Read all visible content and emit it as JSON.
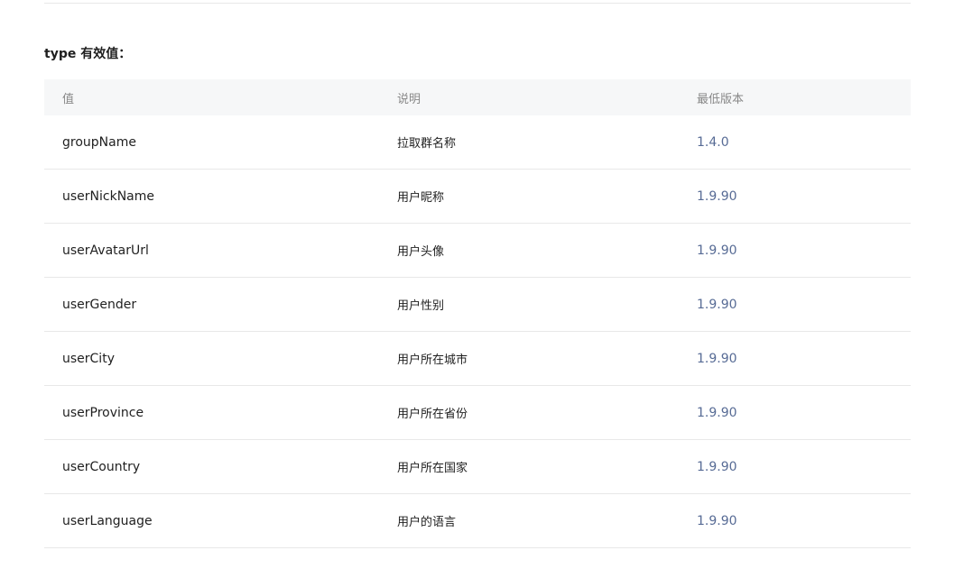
{
  "section": {
    "title": "type 有效值："
  },
  "table": {
    "headers": [
      "值",
      "说明",
      "最低版本"
    ],
    "rows": [
      [
        "groupName",
        "拉取群名称",
        "1.4.0"
      ],
      [
        "userNickName",
        "用户昵称",
        "1.9.90"
      ],
      [
        "userAvatarUrl",
        "用户头像",
        "1.9.90"
      ],
      [
        "userGender",
        "用户性别",
        "1.9.90"
      ],
      [
        "userCity",
        "用户所在城市",
        "1.9.90"
      ],
      [
        "userProvince",
        "用户所在省份",
        "1.9.90"
      ],
      [
        "userCountry",
        "用户所在国家",
        "1.9.90"
      ],
      [
        "userLanguage",
        "用户的语言",
        "1.9.90"
      ]
    ]
  },
  "colors": {
    "link": "#576b95",
    "header_bg": "#f6f7f8",
    "divider": "#e8e8e8"
  }
}
